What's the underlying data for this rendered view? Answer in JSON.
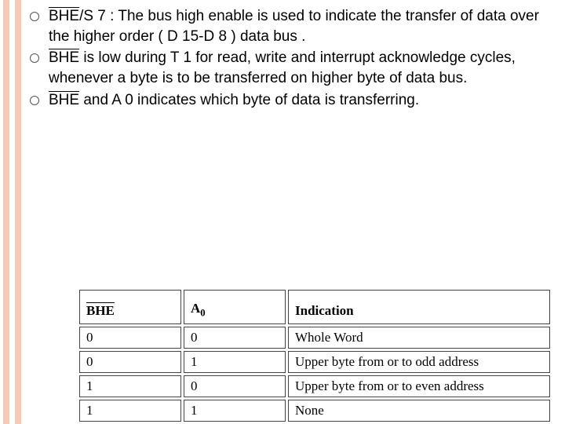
{
  "bullets": [
    {
      "prefix_over": "BHE",
      "rest": "/S 7 : The bus high enable is used to indicate the transfer of data over the higher order ( D 15-D 8 ) data bus ."
    },
    {
      "prefix_over": "BHE",
      "rest": " is low during T 1 for read, write and interrupt acknowledge cycles, whenever a byte is to be transferred on higher byte of data bus."
    },
    {
      "prefix_over": "BHE",
      "rest": " and A 0 indicates which byte of data is transferring."
    }
  ],
  "table": {
    "headers": {
      "col1_over": "BHE",
      "col2": "A",
      "col2_sub": "0",
      "col3": "Indication"
    },
    "rows": [
      {
        "c1": "0",
        "c2": "0",
        "c3": "Whole Word"
      },
      {
        "c1": "0",
        "c2": "1",
        "c3": "Upper byte from or to odd address"
      },
      {
        "c1": "1",
        "c2": "0",
        "c3": "Upper byte from or to even address"
      },
      {
        "c1": "1",
        "c2": "1",
        "c3": "None"
      }
    ]
  }
}
